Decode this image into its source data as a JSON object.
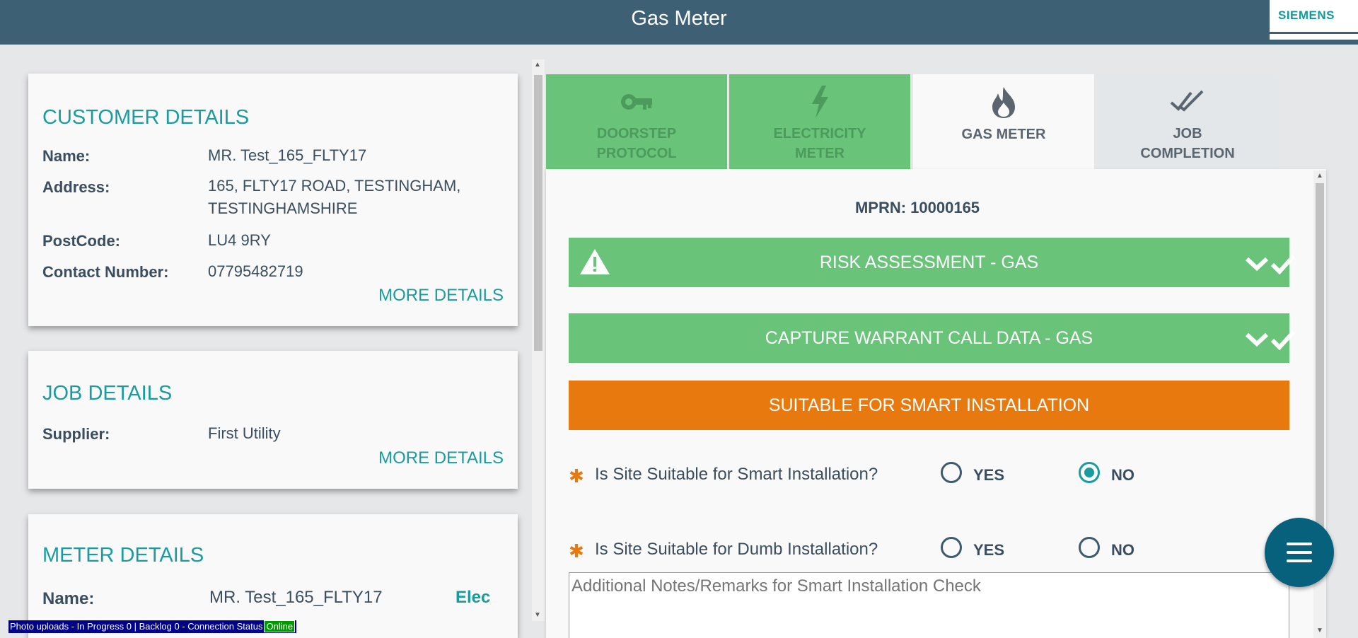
{
  "header": {
    "title": "Gas Meter",
    "brand": "SIEMENS"
  },
  "customer": {
    "heading": "CUSTOMER DETAILS",
    "name_label": "Name:",
    "name": "MR. Test_165_FLTY17",
    "address_label": "Address:",
    "address_line1": "165, FLTY17 ROAD, TESTINGHAM,",
    "address_line2": "TESTINGHAMSHIRE",
    "postcode_label": "PostCode:",
    "postcode": "LU4 9RY",
    "contact_label": "Contact Number:",
    "contact": "07795482719",
    "more": "MORE DETAILS"
  },
  "job": {
    "heading": "JOB DETAILS",
    "supplier_label": "Supplier:",
    "supplier": "First Utility",
    "more": "MORE DETAILS"
  },
  "meter": {
    "heading": "METER DETAILS",
    "name_label": "Name:",
    "name": "MR. Test_165_FLTY17",
    "type": "Elec"
  },
  "status_bar": {
    "text": "Photo uploads - In Progress 0 | Backlog 0 - Connection Status",
    "connection": "Online"
  },
  "tabs": [
    {
      "label": "DOORSTEP\nPROTOCOL",
      "icon": "key-icon",
      "state": "complete"
    },
    {
      "label": "ELECTRICITY\nMETER",
      "icon": "lightning-icon",
      "state": "complete"
    },
    {
      "label": "GAS METER",
      "icon": "flame-icon",
      "state": "active"
    },
    {
      "label": "JOB\nCOMPLETION",
      "icon": "double-check-icon",
      "state": "pending"
    }
  ],
  "panel": {
    "mprn": "MPRN: 10000165",
    "sections": [
      {
        "label": "RISK ASSESSMENT - GAS",
        "status": "complete",
        "color": "#69c47a"
      },
      {
        "label": "CAPTURE WARRANT CALL DATA - GAS",
        "status": "complete",
        "color": "#69c47a"
      },
      {
        "label": "SUITABLE FOR SMART INSTALLATION",
        "status": "open",
        "color": "#e8790f"
      }
    ],
    "questions": [
      {
        "text": "Is Site Suitable for Smart Installation?",
        "yes": "YES",
        "no": "NO",
        "selected": "NO"
      },
      {
        "text": "Is Site Suitable for Dumb Installation?",
        "yes": "YES",
        "no": "NO",
        "selected": null
      }
    ],
    "notes_placeholder": "Additional Notes/Remarks for Smart Installation Check"
  },
  "colors": {
    "header": "#3d6075",
    "accent": "#1a9c9e",
    "complete": "#69c47a",
    "warning": "#e8790f",
    "fab": "#07607c"
  }
}
